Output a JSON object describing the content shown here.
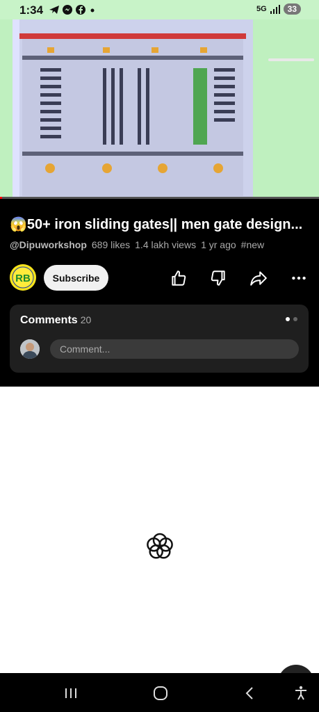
{
  "status_bar": {
    "time": "1:34",
    "notification_icons": [
      "telegram-icon",
      "messenger-icon",
      "facebook-icon",
      "dot-icon"
    ],
    "network": "5G",
    "battery": "33"
  },
  "video": {
    "title": "😱50+ iron sliding gates|| men gate design...",
    "channel": "@Dipuworkshop",
    "likes": "689 likes",
    "views": "1.4 lakh views",
    "age": "1 yr ago",
    "hashtag": "#new"
  },
  "channel_avatar": {
    "text": "RB"
  },
  "actions": {
    "subscribe_label": "Subscribe",
    "like_icon": "thumbs-up-icon",
    "dislike_icon": "thumbs-down-icon",
    "share_icon": "share-icon",
    "more_icon": "more-icon"
  },
  "comments": {
    "label": "Comments",
    "count": "20",
    "placeholder": "Comment..."
  },
  "navigation_bar": {
    "recents_icon": "recents-icon",
    "home_icon": "home-icon",
    "back_icon": "back-icon",
    "accessibility_icon": "accessibility-icon"
  },
  "colors": {
    "status_bar_bg": "#c8f3c8",
    "player_bg": "#000000",
    "card_bg": "#1f1f1f",
    "accent": "#ff0000"
  }
}
